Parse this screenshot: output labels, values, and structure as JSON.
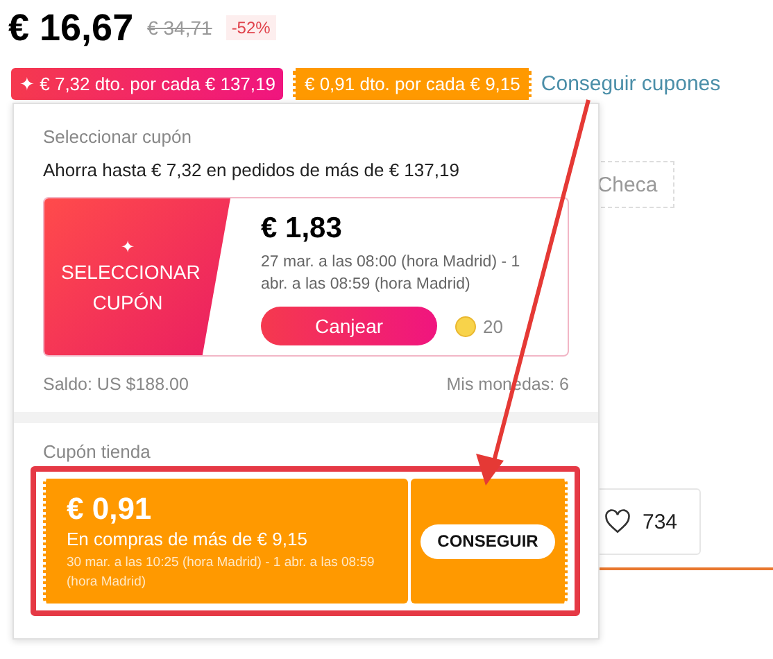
{
  "price": {
    "current": "€ 16,67",
    "original": "€ 34,71",
    "discount": "-52%"
  },
  "coupon_tags": [
    {
      "kind": "platform",
      "icon": "✦",
      "label": "€ 7,32 dto. por cada € 137,19"
    },
    {
      "kind": "store",
      "label": "€ 0,91 dto. por cada € 9,15"
    }
  ],
  "get_coupons_link": "Conseguir cupones",
  "background": {
    "button_label": "Checa",
    "likes": "734"
  },
  "popup": {
    "select_section": {
      "title": "Seleccionar cupón",
      "summary": "Ahorra hasta € 7,32 en pedidos de más de € 137,19",
      "coupon": {
        "badge_icon": "✦",
        "badge_label": "SELECCIONAR CUPÓN",
        "amount": "€ 1,83",
        "validity": "27 mar. a las 08:00 (hora Madrid) - 1 abr. a las 08:59 (hora Madrid)",
        "redeem_button": "Canjear",
        "coin_cost": "20"
      },
      "balance": "Saldo: US $188.00",
      "coins": "Mis monedas: 6"
    },
    "store_section": {
      "title": "Cupón tienda",
      "coupon": {
        "amount": "€ 0,91",
        "condition": "En compras de más de € 9,15",
        "validity": "30 mar. a las 10:25 (hora Madrid) - 1 abr. a las 08:59 (hora Madrid)",
        "button": "CONSEGUIR"
      }
    }
  }
}
